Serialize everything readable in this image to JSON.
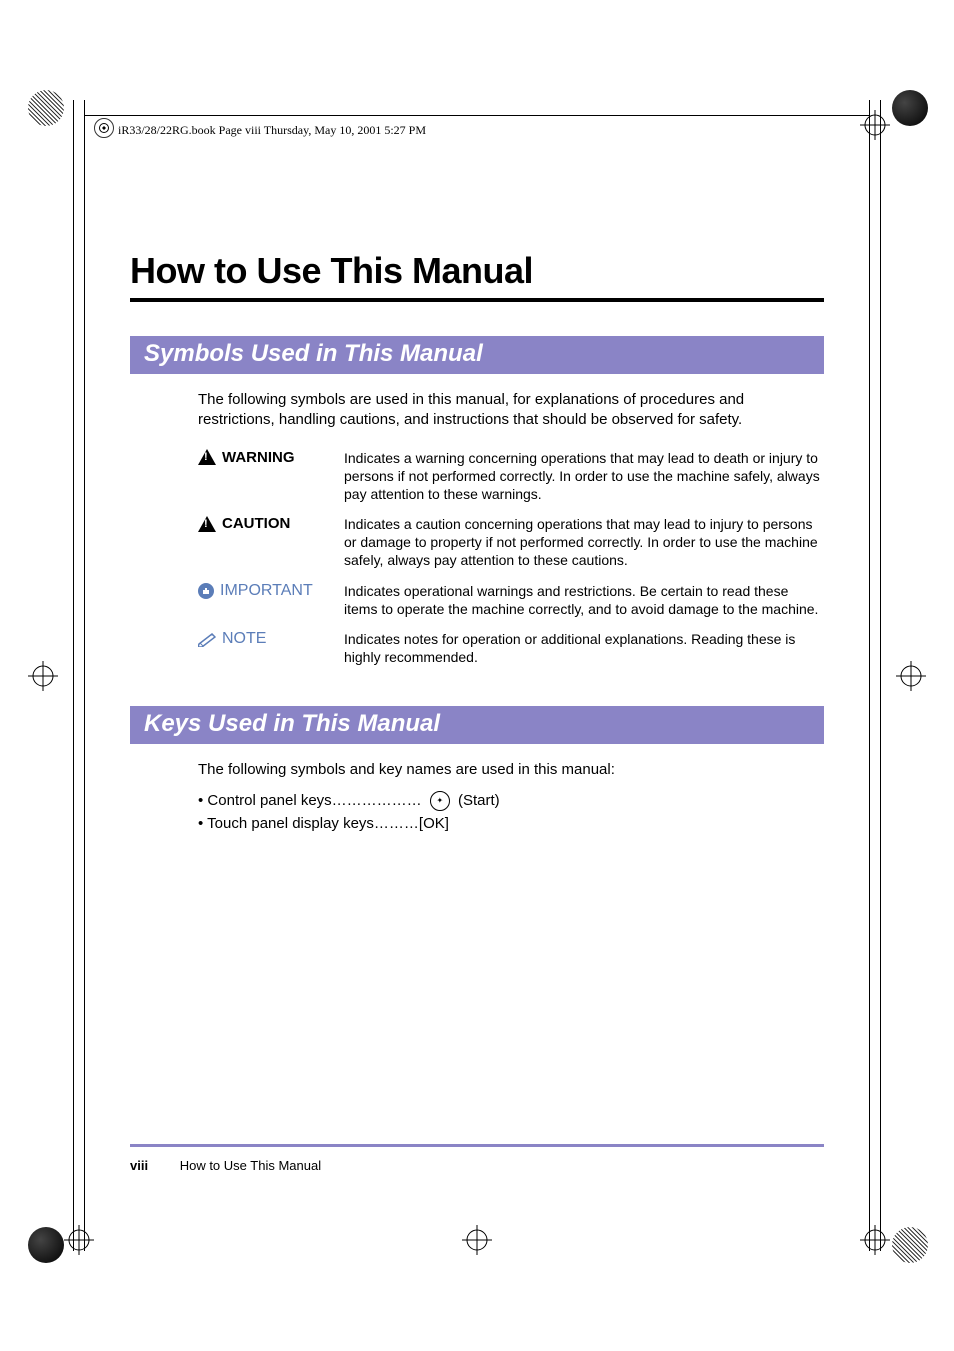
{
  "meta_header": "iR33/28/22RG.book  Page viii  Thursday, May 10, 2001  5:27 PM",
  "main_title": "How to Use This Manual",
  "section1": {
    "title": "Symbols Used in This Manual",
    "intro": "The following symbols are used in this manual, for explanations of procedures and restrictions, handling cautions, and instructions that should be observed for safety.",
    "rows": [
      {
        "label": "WARNING",
        "desc": "Indicates a warning concerning operations that may lead to death or injury to persons if not performed correctly. In order to use the machine safely, always pay attention to these warnings."
      },
      {
        "label": "CAUTION",
        "desc": "Indicates a caution concerning operations that may lead to injury to persons or damage to property if not performed correctly. In order to use the machine safely, always pay attention to these cautions."
      },
      {
        "label": "IMPORTANT",
        "desc": "Indicates operational warnings and restrictions. Be certain to read these items to operate the machine correctly, and to avoid damage to the machine."
      },
      {
        "label": "NOTE",
        "desc": "Indicates notes for operation or additional explanations. Reading these is highly recommended."
      }
    ]
  },
  "section2": {
    "title": "Keys Used in This Manual",
    "intro": "The following symbols and key names are used in this manual:",
    "items": [
      {
        "prefix": "Control panel keys………………",
        "suffix": " (Start)",
        "has_icon": true
      },
      {
        "prefix": "Touch panel display keys………[OK]",
        "suffix": "",
        "has_icon": false
      }
    ]
  },
  "footer": {
    "page_number": "viii",
    "title": "How to Use This Manual"
  }
}
